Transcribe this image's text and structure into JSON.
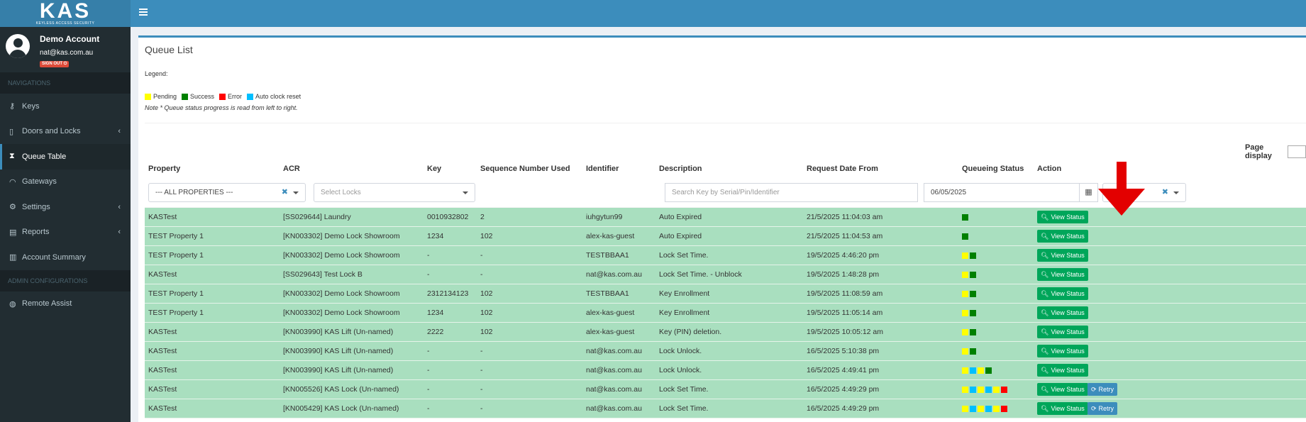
{
  "brand": {
    "logo_text": "KAS",
    "logo_sub": "KEYLESS ACCESS SECURITY"
  },
  "user": {
    "name": "Demo Account",
    "email": "nat@kas.com.au",
    "signout": "SIGN OUT ⏻"
  },
  "sidebar": {
    "header_nav": "NAVIGATIONS",
    "header_admin": "ADMIN CONFIGURATIONS",
    "items": [
      {
        "label": "Keys",
        "icon": "⚷"
      },
      {
        "label": "Doors and Locks",
        "icon": "▯",
        "chev": "‹"
      },
      {
        "label": "Queue Table",
        "icon": "⧗"
      },
      {
        "label": "Gateways",
        "icon": "◠"
      },
      {
        "label": "Settings",
        "icon": "⚙",
        "chev": "‹"
      },
      {
        "label": "Reports",
        "icon": "▤",
        "chev": "‹"
      },
      {
        "label": "Account Summary",
        "icon": "▥"
      }
    ],
    "admin_items": [
      {
        "label": "Remote Assist",
        "icon": "◍"
      }
    ]
  },
  "page": {
    "title": "Queue List",
    "legend_label": "Legend:",
    "legend": [
      {
        "label": "Pending",
        "color": "#ffff00"
      },
      {
        "label": "Success",
        "color": "#008000"
      },
      {
        "label": "Error",
        "color": "#ff0000"
      },
      {
        "label": "Auto clock reset",
        "color": "#00bfff"
      }
    ],
    "note": "Note * Queue status progress is read from left to right.",
    "page_display": "Page display"
  },
  "table": {
    "headers": [
      "Property",
      "ACR",
      "Key",
      "Sequence Number Used",
      "Identifier",
      "Description",
      "Request Date From",
      "Queueing Status",
      "Action"
    ],
    "filters": {
      "property": "--- ALL PROPERTIES ---",
      "acr": "Select Locks",
      "search_placeholder": "Search Key by Serial/Pin/Identifier",
      "date": "06/05/2025"
    },
    "view_label": "View Status",
    "retry_label": "Retry",
    "rows": [
      {
        "property": "KASTest",
        "acr": "[SS029644] Laundry",
        "key": "0010932802",
        "seq": "2",
        "identifier": "iuhgytun99",
        "description": "Auto Expired",
        "date": "21/5/2025 11:04:03 am",
        "status": [
          "#008000"
        ],
        "retry": false
      },
      {
        "property": "TEST Property 1",
        "acr": "[KN003302] Demo Lock Showroom",
        "key": "1234",
        "seq": "102",
        "identifier": "alex-kas-guest",
        "description": "Auto Expired",
        "date": "21/5/2025 11:04:53 am",
        "status": [
          "#008000"
        ],
        "retry": false
      },
      {
        "property": "TEST Property 1",
        "acr": "[KN003302] Demo Lock Showroom",
        "key": "-",
        "seq": "-",
        "identifier": "TESTBBAA1",
        "description": "Lock Set Time.",
        "date": "19/5/2025 4:46:20 pm",
        "status": [
          "#ffff00",
          "#008000"
        ],
        "retry": false
      },
      {
        "property": "KASTest",
        "acr": "[SS029643] Test Lock B",
        "key": "-",
        "seq": "-",
        "identifier": "nat@kas.com.au",
        "description": "Lock Set Time. - Unblock",
        "date": "19/5/2025 1:48:28 pm",
        "status": [
          "#ffff00",
          "#008000"
        ],
        "retry": false
      },
      {
        "property": "TEST Property 1",
        "acr": "[KN003302] Demo Lock Showroom",
        "key": "2312134123",
        "seq": "102",
        "identifier": "TESTBBAA1",
        "description": "Key Enrollment",
        "date": "19/5/2025 11:08:59 am",
        "status": [
          "#ffff00",
          "#008000"
        ],
        "retry": false
      },
      {
        "property": "TEST Property 1",
        "acr": "[KN003302] Demo Lock Showroom",
        "key": "1234",
        "seq": "102",
        "identifier": "alex-kas-guest",
        "description": "Key Enrollment",
        "date": "19/5/2025 11:05:14 am",
        "status": [
          "#ffff00",
          "#008000"
        ],
        "retry": false
      },
      {
        "property": "KASTest",
        "acr": "[KN003990] KAS Lift (Un-named)",
        "key": "2222",
        "seq": "102",
        "identifier": "alex-kas-guest",
        "description": "Key (PIN) deletion.",
        "date": "19/5/2025 10:05:12 am",
        "status": [
          "#ffff00",
          "#008000"
        ],
        "retry": false
      },
      {
        "property": "KASTest",
        "acr": "[KN003990] KAS Lift (Un-named)",
        "key": "-",
        "seq": "-",
        "identifier": "nat@kas.com.au",
        "description": "Lock Unlock.",
        "date": "16/5/2025 5:10:38 pm",
        "status": [
          "#ffff00",
          "#008000"
        ],
        "retry": false
      },
      {
        "property": "KASTest",
        "acr": "[KN003990] KAS Lift (Un-named)",
        "key": "-",
        "seq": "-",
        "identifier": "nat@kas.com.au",
        "description": "Lock Unlock.",
        "date": "16/5/2025 4:49:41 pm",
        "status": [
          "#ffff00",
          "#00bfff",
          "#ffff00",
          "#008000"
        ],
        "retry": false
      },
      {
        "property": "KASTest",
        "acr": "[KN005526] KAS Lock (Un-named)",
        "key": "-",
        "seq": "-",
        "identifier": "nat@kas.com.au",
        "description": "Lock Set Time.",
        "date": "16/5/2025 4:49:29 pm",
        "status": [
          "#ffff00",
          "#00bfff",
          "#ffff00",
          "#00bfff",
          "#ffff00",
          "#ff0000"
        ],
        "retry": true
      },
      {
        "property": "KASTest",
        "acr": "[KN005429] KAS Lock (Un-named)",
        "key": "-",
        "seq": "-",
        "identifier": "nat@kas.com.au",
        "description": "Lock Set Time.",
        "date": "16/5/2025 4:49:29 pm",
        "status": [
          "#ffff00",
          "#00bfff",
          "#ffff00",
          "#00bfff",
          "#ffff00",
          "#ff0000"
        ],
        "retry": true
      }
    ]
  }
}
